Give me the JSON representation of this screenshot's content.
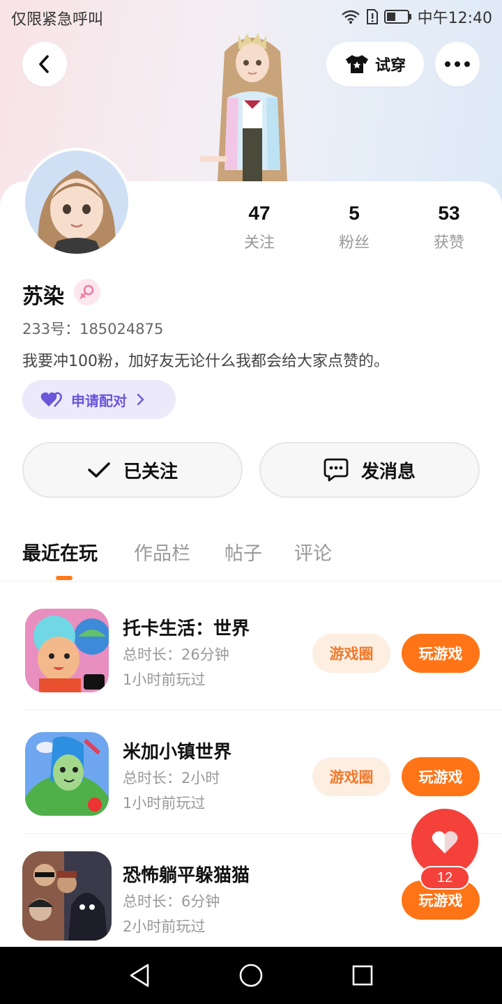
{
  "status_bar": {
    "carrier_text": "仅限紧急呼叫",
    "time": "中午12:40",
    "icons": [
      "wifi-icon",
      "sim-alert-icon",
      "battery-icon"
    ]
  },
  "header": {
    "try_on_label": "试穿",
    "back_icon": "chevron-left-icon",
    "more_icon": "more-dots-icon",
    "shirt_icon": "shirt-icon"
  },
  "profile": {
    "name": "苏染",
    "gender_icon": "female-icon",
    "id_text": "233号：185024875",
    "bio": "我要冲100粉，加好友无论什么我都会给大家点赞的。",
    "match_label": "申请配对",
    "stats": [
      {
        "value": "47",
        "label": "关注"
      },
      {
        "value": "5",
        "label": "粉丝"
      },
      {
        "value": "53",
        "label": "获赞"
      }
    ]
  },
  "actions": {
    "follow_label": "已关注",
    "message_label": "发消息"
  },
  "tabs": [
    {
      "label": "最近在玩",
      "active": true
    },
    {
      "label": "作品栏",
      "active": false
    },
    {
      "label": "帖子",
      "active": false
    },
    {
      "label": "评论",
      "active": false
    }
  ],
  "games": [
    {
      "title": "托卡生活：世界",
      "duration": "总时长：26分钟",
      "last_played": "1小时前玩过",
      "circle_label": "游戏圈",
      "play_label": "玩游戏"
    },
    {
      "title": "米加小镇世界",
      "duration": "总时长：2小时",
      "last_played": "1小时前玩过",
      "circle_label": "游戏圈",
      "play_label": "玩游戏"
    },
    {
      "title": "恐怖躺平躲猫猫",
      "duration": "总时长：6分钟",
      "last_played": "2小时前玩过",
      "play_label": "玩游戏"
    }
  ],
  "fab": {
    "badge": "12",
    "icon": "heart-icon"
  },
  "colors": {
    "accent": "#ff7416",
    "match": "#6b56d9",
    "fab": "#f4413a"
  }
}
